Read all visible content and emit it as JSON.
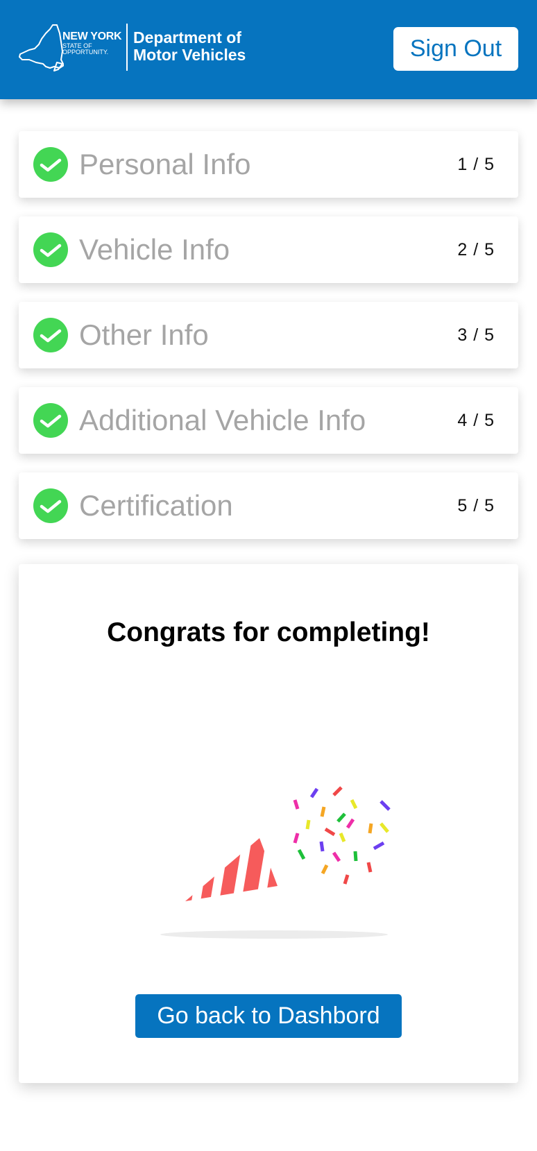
{
  "header": {
    "logo": {
      "state_name": "NEW YORK",
      "tagline_line1": "STATE OF",
      "tagline_line2": "OPPORTUNITY.",
      "dept_line1": "Department of",
      "dept_line2": "Motor Vehicles"
    },
    "sign_out_label": "Sign Out"
  },
  "steps": [
    {
      "label": "Personal Info",
      "count": "1 / 5",
      "completed": true,
      "icon": "check-circle-icon"
    },
    {
      "label": "Vehicle Info",
      "count": "2 / 5",
      "completed": true,
      "icon": "check-circle-icon"
    },
    {
      "label": "Other Info",
      "count": "3 / 5",
      "completed": true,
      "icon": "check-circle-icon"
    },
    {
      "label": "Additional Vehicle Info",
      "count": "4 / 5",
      "completed": true,
      "icon": "check-circle-icon"
    },
    {
      "label": "Certification",
      "count": "5 / 5",
      "completed": true,
      "icon": "check-circle-icon"
    }
  ],
  "completion": {
    "title": "Congrats for completing!",
    "illustration": "party-popper-icon",
    "back_button_label": "Go back to Dashbord"
  },
  "colors": {
    "brand_blue": "#0674bf",
    "check_green": "#43d654",
    "step_label_gray": "#a5a5a5",
    "popper_red": "#f65b5b"
  }
}
